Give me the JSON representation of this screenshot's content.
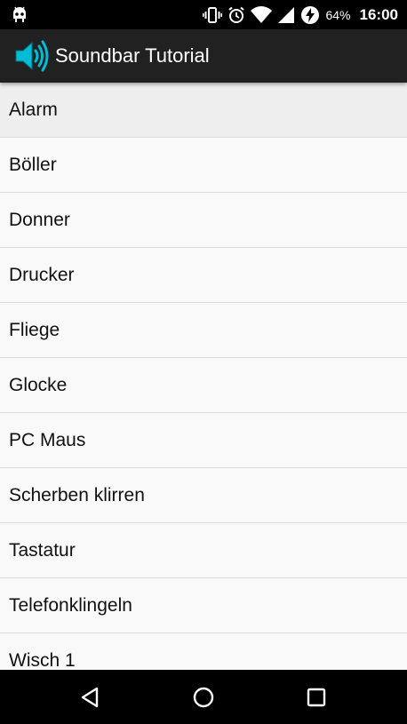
{
  "status_bar": {
    "battery_percent": "64%",
    "time": "16:00",
    "icons": [
      "android-debug-icon",
      "vibrate-icon",
      "alarm-clock-icon",
      "wifi-icon",
      "signal-icon",
      "battery-charging-icon"
    ]
  },
  "action_bar": {
    "title": "Soundbar Tutorial",
    "icon": "speaker-icon",
    "accent_color": "#00bcd4",
    "background_color": "#212121"
  },
  "sounds": {
    "items": [
      {
        "label": "Alarm"
      },
      {
        "label": "Böller"
      },
      {
        "label": "Donner"
      },
      {
        "label": "Drucker"
      },
      {
        "label": "Fliege"
      },
      {
        "label": "Glocke"
      },
      {
        "label": "PC Maus"
      },
      {
        "label": "Scherben klirren"
      },
      {
        "label": "Tastatur"
      },
      {
        "label": "Telefonklingeln"
      },
      {
        "label": "Wisch 1"
      }
    ]
  },
  "nav_bar": {
    "icons": [
      "back-icon",
      "home-icon",
      "recents-icon"
    ]
  }
}
